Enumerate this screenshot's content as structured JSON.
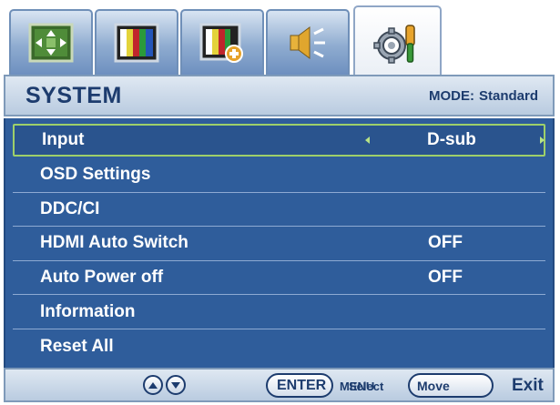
{
  "tabs": [
    {
      "name": "display-tab",
      "icon": "picture-adjust-icon",
      "active": false
    },
    {
      "name": "picture-tab",
      "icon": "color-bars-icon",
      "active": false
    },
    {
      "name": "picture-advanced-tab",
      "icon": "color-bars-plus-icon",
      "active": false
    },
    {
      "name": "audio-tab",
      "icon": "speaker-icon",
      "active": false
    },
    {
      "name": "system-tab",
      "icon": "gear-wrench-icon",
      "active": true
    }
  ],
  "header": {
    "title": "SYSTEM",
    "mode_label": "MODE:",
    "mode_value": "Standard"
  },
  "menu": {
    "items": [
      {
        "label": "Input",
        "value": "D-sub",
        "selected": true
      },
      {
        "label": "OSD Settings",
        "value": ""
      },
      {
        "label": "DDC/CI",
        "value": ""
      },
      {
        "label": "HDMI Auto Switch",
        "value": "OFF"
      },
      {
        "label": "Auto Power off",
        "value": "OFF"
      },
      {
        "label": "Information",
        "value": ""
      },
      {
        "label": "Reset All",
        "value": ""
      }
    ]
  },
  "footer": {
    "enter": "ENTER",
    "menu": "MENU",
    "select": "Select",
    "move": "Move",
    "exit": "Exit"
  },
  "colors": {
    "menu_background": "#2f5d9b",
    "selection_border": "#9ed06a",
    "header_text": "#1d3c6e"
  }
}
